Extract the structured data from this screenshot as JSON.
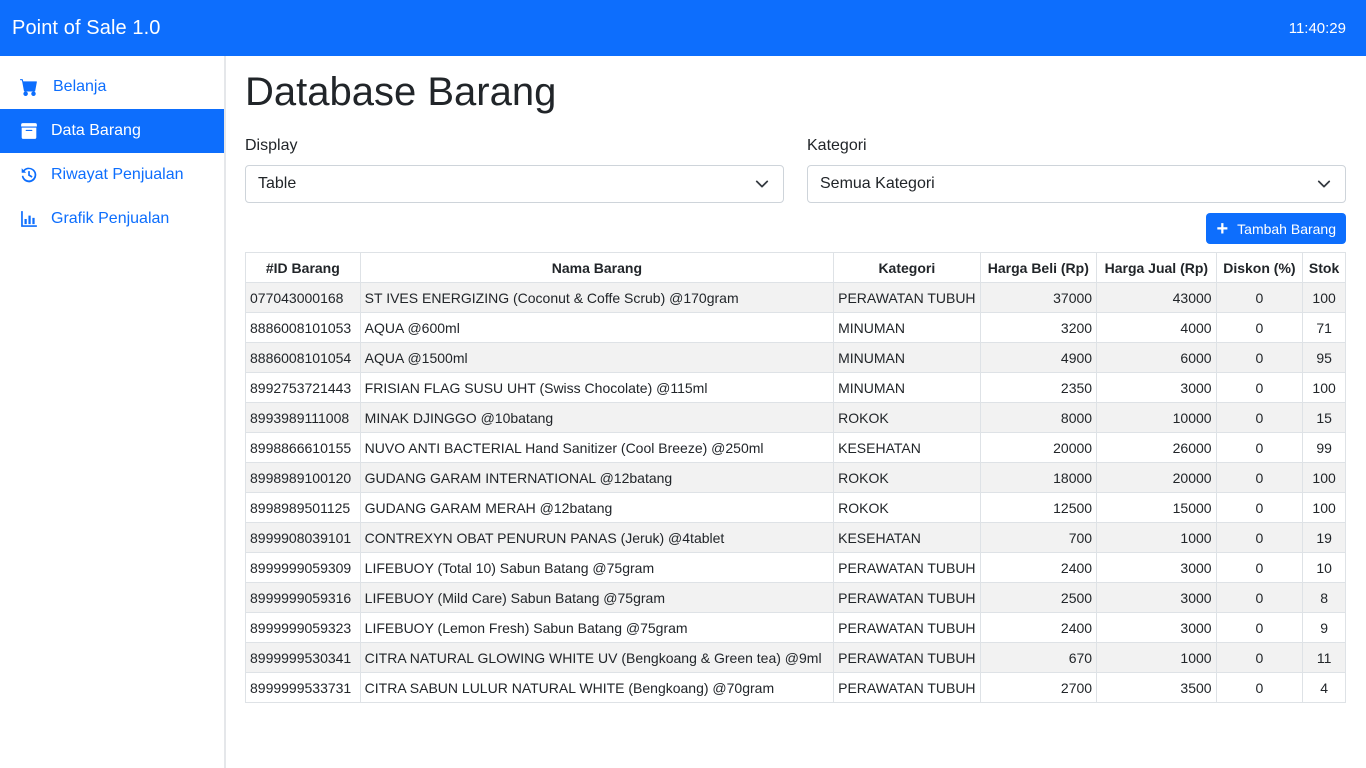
{
  "app": {
    "title": "Point of Sale 1.0",
    "clock": "11:40:29"
  },
  "sidebar": {
    "items": [
      {
        "label": "Belanja",
        "icon": "cart-icon",
        "active": false
      },
      {
        "label": "Data Barang",
        "icon": "archive-icon",
        "active": true
      },
      {
        "label": "Riwayat Penjualan",
        "icon": "history-icon",
        "active": false
      },
      {
        "label": "Grafik Penjualan",
        "icon": "chart-icon",
        "active": false
      }
    ]
  },
  "page": {
    "title": "Database Barang"
  },
  "filters": {
    "display": {
      "label": "Display",
      "value": "Table"
    },
    "kategori": {
      "label": "Kategori",
      "value": "Semua Kategori"
    }
  },
  "actions": {
    "add_label": "Tambah Barang"
  },
  "table": {
    "headers": [
      "#ID Barang",
      "Nama Barang",
      "Kategori",
      "Harga Beli (Rp)",
      "Harga Jual (Rp)",
      "Diskon (%)",
      "Stok"
    ],
    "rows": [
      [
        "077043000168",
        "ST IVES ENERGIZING (Coconut & Coffe Scrub) @170gram",
        "PERAWATAN TUBUH",
        "37000",
        "43000",
        "0",
        "100"
      ],
      [
        "8886008101053",
        "AQUA @600ml",
        "MINUMAN",
        "3200",
        "4000",
        "0",
        "71"
      ],
      [
        "8886008101054",
        "AQUA @1500ml",
        "MINUMAN",
        "4900",
        "6000",
        "0",
        "95"
      ],
      [
        "8992753721443",
        "FRISIAN FLAG SUSU UHT (Swiss Chocolate) @115ml",
        "MINUMAN",
        "2350",
        "3000",
        "0",
        "100"
      ],
      [
        "8993989111008",
        "MINAK DJINGGO @10batang",
        "ROKOK",
        "8000",
        "10000",
        "0",
        "15"
      ],
      [
        "8998866610155",
        "NUVO ANTI BACTERIAL Hand Sanitizer (Cool Breeze) @250ml",
        "KESEHATAN",
        "20000",
        "26000",
        "0",
        "99"
      ],
      [
        "8998989100120",
        "GUDANG GARAM INTERNATIONAL @12batang",
        "ROKOK",
        "18000",
        "20000",
        "0",
        "100"
      ],
      [
        "8998989501125",
        "GUDANG GARAM MERAH @12batang",
        "ROKOK",
        "12500",
        "15000",
        "0",
        "100"
      ],
      [
        "8999908039101",
        "CONTREXYN OBAT PENURUN PANAS (Jeruk) @4tablet",
        "KESEHATAN",
        "700",
        "1000",
        "0",
        "19"
      ],
      [
        "8999999059309",
        "LIFEBUOY (Total 10) Sabun Batang @75gram",
        "PERAWATAN TUBUH",
        "2400",
        "3000",
        "0",
        "10"
      ],
      [
        "8999999059316",
        "LIFEBUOY (Mild Care) Sabun Batang @75gram",
        "PERAWATAN TUBUH",
        "2500",
        "3000",
        "0",
        "8"
      ],
      [
        "8999999059323",
        "LIFEBUOY (Lemon Fresh) Sabun Batang @75gram",
        "PERAWATAN TUBUH",
        "2400",
        "3000",
        "0",
        "9"
      ],
      [
        "8999999530341",
        "CITRA NATURAL GLOWING WHITE UV (Bengkoang & Green tea) @9ml",
        "PERAWATAN TUBUH",
        "670",
        "1000",
        "0",
        "11"
      ],
      [
        "8999999533731",
        "CITRA SABUN LULUR NATURAL WHITE (Bengkoang) @70gram",
        "PERAWATAN TUBUH",
        "2700",
        "3500",
        "0",
        "4"
      ]
    ]
  },
  "colors": {
    "primary": "#0d6efd",
    "stripe": "#f2f2f2",
    "border": "#dee2e6"
  }
}
